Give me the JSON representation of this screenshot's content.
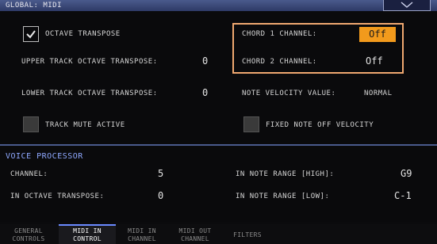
{
  "header": {
    "title": "GLOBAL: MIDI",
    "menu_icon": "chevron-down-icon"
  },
  "midi": {
    "octave_transpose_label": "OCTAVE TRANSPOSE",
    "octave_transpose_checked": true,
    "upper_label": "UPPER TRACK OCTAVE TRANSPOSE:",
    "upper_value": "0",
    "lower_label": "LOWER TRACK OCTAVE TRANSPOSE:",
    "lower_value": "0",
    "track_mute_label": "TRACK MUTE ACTIVE",
    "track_mute_checked": false,
    "chord1_label": "CHORD 1 CHANNEL:",
    "chord1_value": "Off",
    "chord2_label": "CHORD 2 CHANNEL:",
    "chord2_value": "Off",
    "velocity_label": "NOTE VELOCITY VALUE:",
    "velocity_value": "NORMAL",
    "fixed_note_label": "FIXED NOTE OFF VELOCITY",
    "fixed_note_checked": false
  },
  "voice_processor": {
    "title": "VOICE PROCESSOR",
    "channel_label": "CHANNEL:",
    "channel_value": "5",
    "octave_label": "IN OCTAVE TRANSPOSE:",
    "octave_value": "0",
    "range_high_label": "IN NOTE RANGE [HIGH]:",
    "range_high_value": "G9",
    "range_low_label": "IN NOTE RANGE [LOW]:",
    "range_low_value": "C-1"
  },
  "tabs": [
    {
      "line1": "GENERAL",
      "line2": "CONTROLS",
      "active": false
    },
    {
      "line1": "MIDI IN",
      "line2": "CONTROL",
      "active": true
    },
    {
      "line1": "MIDI IN",
      "line2": "CHANNEL",
      "active": false
    },
    {
      "line1": "MIDI OUT",
      "line2": "CHANNEL",
      "active": false
    },
    {
      "line1": "",
      "line2": "FILTERS",
      "active": false
    }
  ],
  "colors": {
    "accent": "#f29a1c",
    "highlight_border": "#f0a870",
    "title_bar": "#3a4a7c",
    "section_title": "#8fa8ff"
  }
}
